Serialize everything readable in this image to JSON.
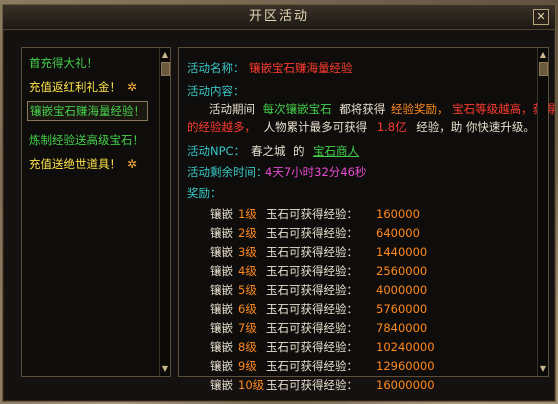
{
  "window": {
    "title": "开区活动",
    "close_label": "✕"
  },
  "left_list": [
    {
      "label": "首充得大礼！",
      "color": "green",
      "has_gift": false
    },
    {
      "label": "充值返红利礼金！",
      "color": "yellow",
      "has_gift": true
    },
    {
      "label": "镶嵌宝石赚海量经验！",
      "color": "green",
      "has_gift": false,
      "selected": true
    },
    {
      "label": "炼制经验送高级宝石！",
      "color": "green",
      "has_gift": false
    },
    {
      "label": "充值送绝世道具！",
      "color": "yellow",
      "has_gift": true
    }
  ],
  "detail": {
    "name_label": "活动名称：",
    "name_value": "镶嵌宝石赚海量经验",
    "content_label": "活动内容：",
    "content_line1_a": "活动期间",
    "content_line1_b": "每次镶嵌宝石",
    "content_line1_c": "都将获得",
    "content_line1_d": "经验奖励，",
    "content_line1_e": "宝石等级越高，获得",
    "content_line2_a": "的经验越多，",
    "content_line2_b": "人物累计最多可获得",
    "content_line2_c": "1.8亿",
    "content_line2_d": "经验，助 你快速升级。",
    "npc_label": "活动NPC：",
    "npc_city": "春之城",
    "npc_of": "的",
    "npc_name": "宝石商人",
    "time_label": "活动剩余时间：",
    "time_value": "4天7小时32分46秒",
    "reward_label": "奖励："
  },
  "rewards": [
    {
      "prefix": "镶嵌",
      "level": "1级",
      "text": "玉石可获得经验：",
      "exp": "160000"
    },
    {
      "prefix": "镶嵌",
      "level": "2级",
      "text": "玉石可获得经验：",
      "exp": "640000"
    },
    {
      "prefix": "镶嵌",
      "level": "3级",
      "text": "玉石可获得经验：",
      "exp": "1440000"
    },
    {
      "prefix": "镶嵌",
      "level": "4级",
      "text": "玉石可获得经验：",
      "exp": "2560000"
    },
    {
      "prefix": "镶嵌",
      "level": "5级",
      "text": "玉石可获得经验：",
      "exp": "4000000"
    },
    {
      "prefix": "镶嵌",
      "level": "6级",
      "text": "玉石可获得经验：",
      "exp": "5760000"
    },
    {
      "prefix": "镶嵌",
      "level": "7级",
      "text": "玉石可获得经验：",
      "exp": "7840000"
    },
    {
      "prefix": "镶嵌",
      "level": "8级",
      "text": "玉石可获得经验：",
      "exp": "10240000"
    },
    {
      "prefix": "镶嵌",
      "level": "9级",
      "text": "玉石可获得经验：",
      "exp": "12960000"
    },
    {
      "prefix": "镶嵌",
      "level": "10级",
      "text": "玉石可获得经验：",
      "exp": "16000000"
    }
  ],
  "icons": {
    "gift": "gift-icon",
    "close": "close-icon",
    "scroll_up": "scroll-up-arrow-icon",
    "scroll_down": "scroll-down-arrow-icon"
  },
  "colors": {
    "label_cyan": "#38c7c7",
    "highlight_red": "#ff3b2f",
    "highlight_orange": "#ff8a1e",
    "green": "#43d14a",
    "yellow": "#ffe54a"
  }
}
